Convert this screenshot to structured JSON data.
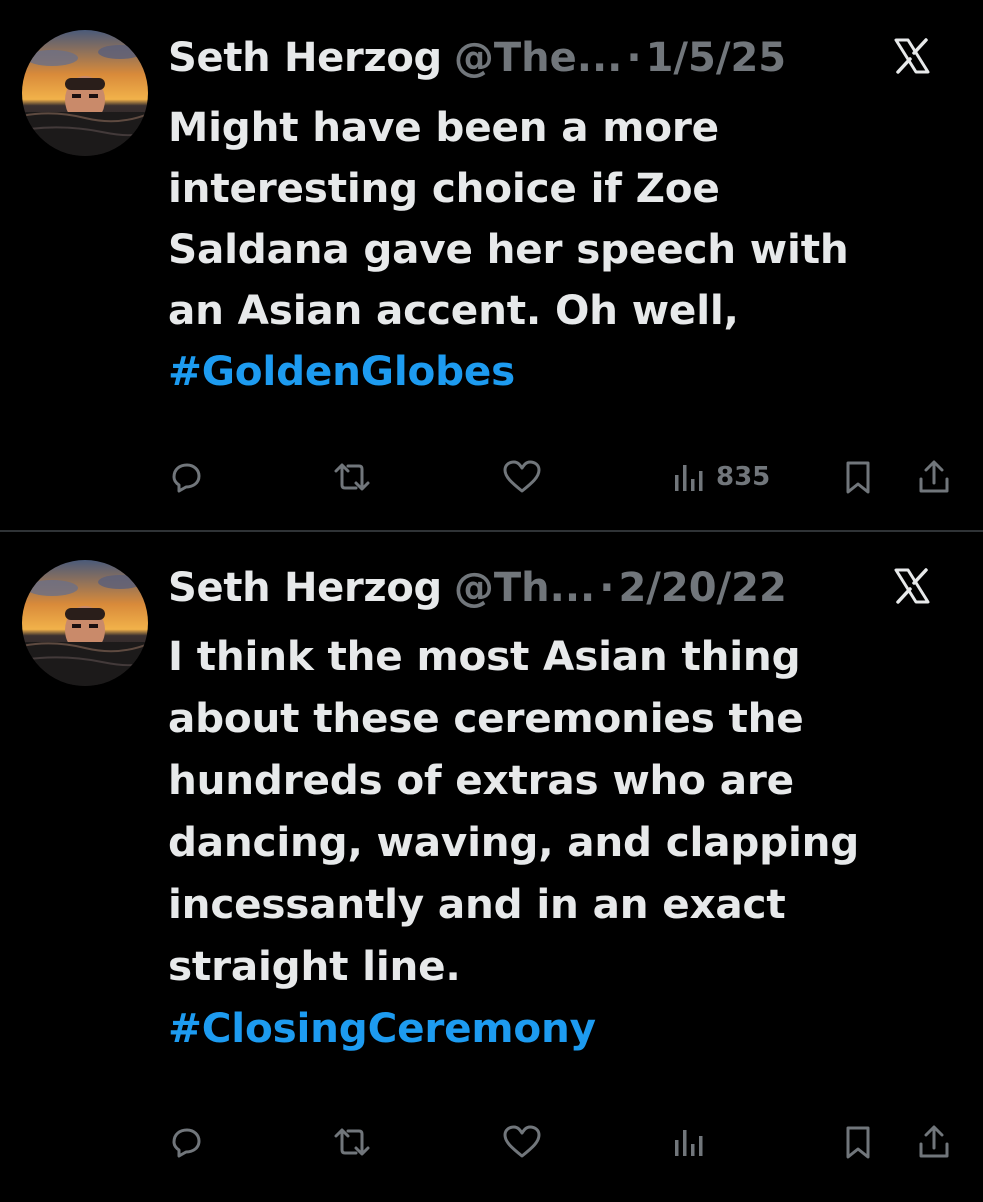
{
  "tweets": [
    {
      "author_name": "Seth Herzog",
      "handle": "@The...",
      "separator": "·",
      "date": "1/5/25",
      "lines": [
        "Might have been a more",
        "interesting choice if Zoe",
        "Saldana gave her speech with",
        "an Asian accent. Oh well,"
      ],
      "hashtag": "#GoldenGlobes",
      "views": "835"
    },
    {
      "author_name": "Seth Herzog",
      "handle": "@Th...",
      "separator": "·",
      "date": "2/20/22",
      "lines": [
        "I think the most Asian thing",
        "about these ceremonies the",
        "hundreds of extras who are",
        "dancing, waving, and clapping",
        "incessantly and in an exact",
        "straight line."
      ],
      "hashtag": "#ClosingCeremony",
      "views": ""
    }
  ],
  "icons": {
    "brand": "x-logo-icon",
    "reply": "reply-icon",
    "repost": "repost-icon",
    "like": "like-icon",
    "views": "views-icon",
    "bookmark": "bookmark-icon",
    "share": "share-icon"
  },
  "colors": {
    "background": "#000000",
    "text": "#e7e9ea",
    "muted": "#71767b",
    "hashtag": "#1d9bf0",
    "divider": "#2f3336"
  }
}
